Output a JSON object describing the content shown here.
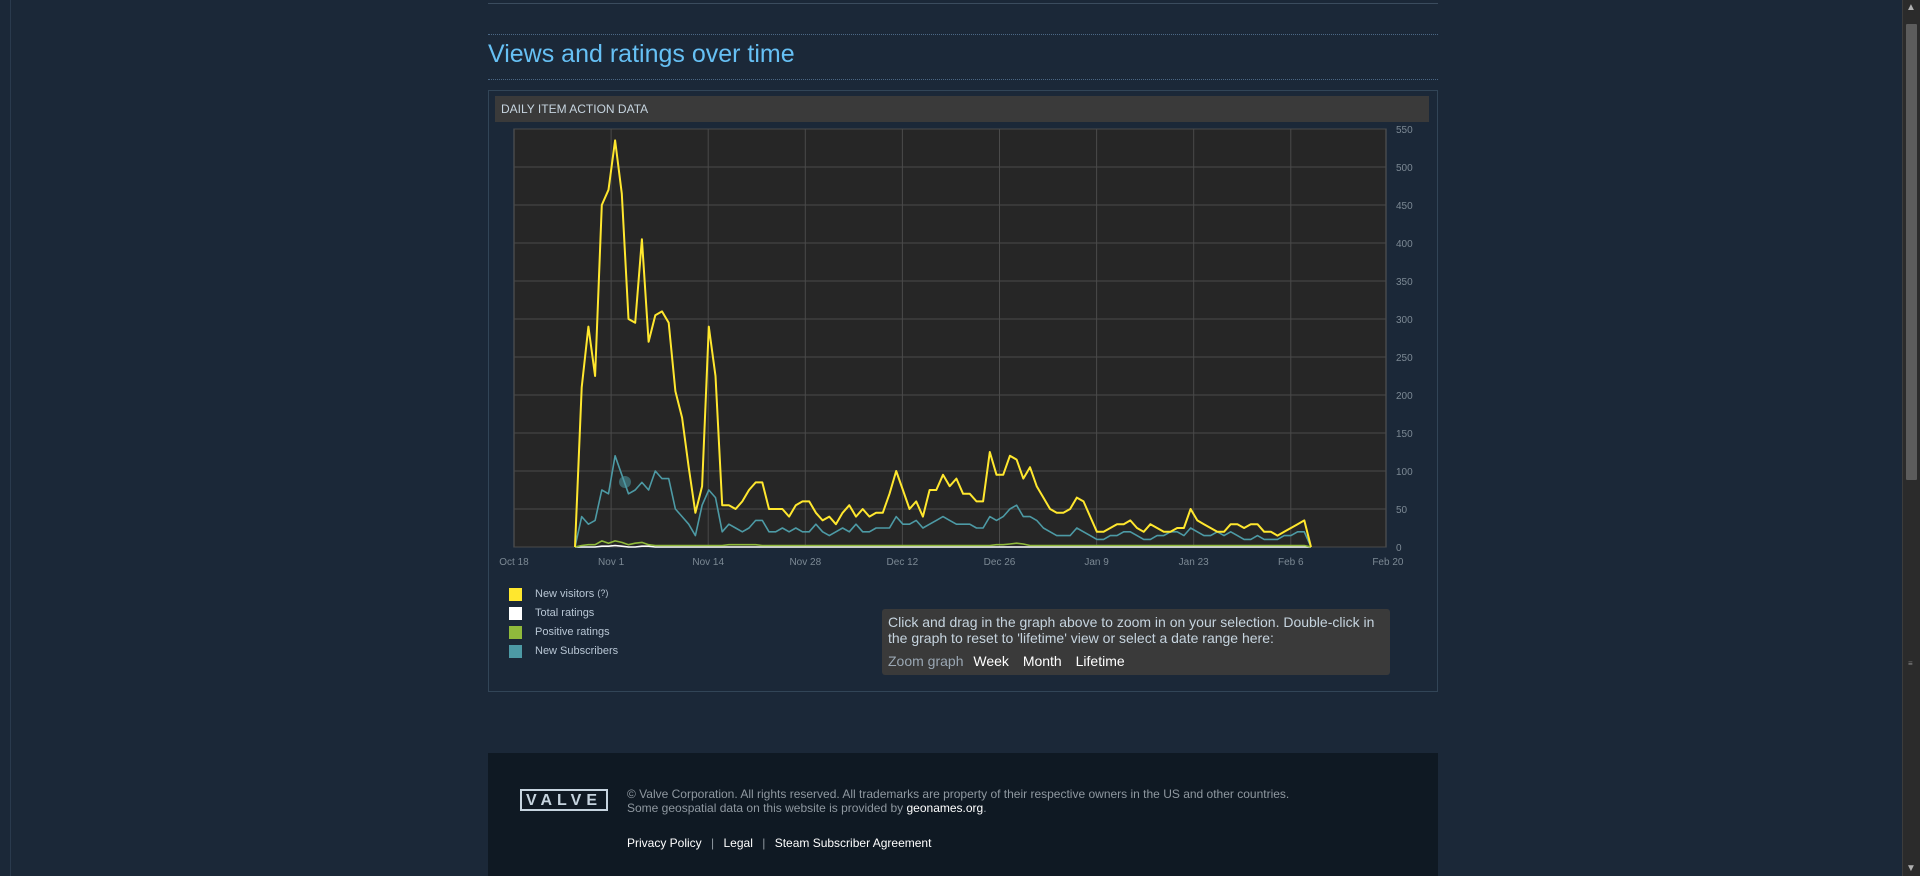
{
  "section": {
    "title": "Views and ratings over time"
  },
  "panel": {
    "header": "DAILY ITEM ACTION DATA"
  },
  "chart_data": {
    "type": "line",
    "y_ticks": [
      "550",
      "500",
      "450",
      "400",
      "350",
      "300",
      "250",
      "200",
      "150",
      "100",
      "50",
      "0"
    ],
    "x_ticks": [
      "Oct 18",
      "Nov 1",
      "Nov 14",
      "Nov 28",
      "Dec 12",
      "Dec 26",
      "Jan 9",
      "Jan 23",
      "Feb 6",
      "Feb 20"
    ],
    "ylim": [
      0,
      550
    ],
    "grid": true,
    "series": [
      {
        "name": "New visitors",
        "color": "#ffe72e",
        "values": [
          0,
          210,
          290,
          225,
          450,
          470,
          535,
          465,
          300,
          295,
          405,
          270,
          305,
          310,
          295,
          205,
          170,
          105,
          45,
          80,
          290,
          225,
          55,
          55,
          50,
          60,
          75,
          85,
          85,
          50,
          50,
          50,
          40,
          55,
          60,
          60,
          45,
          35,
          40,
          30,
          45,
          55,
          40,
          50,
          40,
          45,
          45,
          70,
          100,
          75,
          50,
          60,
          40,
          75,
          75,
          95,
          80,
          90,
          70,
          70,
          60,
          60,
          125,
          95,
          95,
          120,
          115,
          90,
          105,
          80,
          65,
          50,
          45,
          45,
          50,
          65,
          60,
          40,
          20,
          20,
          25,
          30,
          30,
          35,
          25,
          20,
          30,
          25,
          20,
          20,
          25,
          25,
          50,
          35,
          30,
          25,
          20,
          20,
          30,
          30,
          25,
          30,
          30,
          20,
          20,
          15,
          20,
          25,
          30,
          35,
          0
        ]
      },
      {
        "name": "Total ratings",
        "color": "#ffffff",
        "values": [
          0,
          0,
          0,
          0,
          1,
          1,
          2,
          1,
          0,
          0,
          1,
          1,
          0,
          0,
          0,
          0,
          0,
          0,
          0,
          0,
          0,
          0,
          0,
          0,
          0,
          0,
          0,
          0,
          0,
          0,
          0,
          0,
          0,
          0,
          0,
          0,
          0,
          0,
          0,
          0,
          0,
          0,
          0,
          0,
          0,
          0,
          0,
          0,
          0,
          0,
          0,
          0,
          0,
          0,
          0,
          0,
          0,
          0,
          0,
          0,
          0,
          0,
          0,
          0,
          0,
          0,
          0,
          0,
          0,
          0,
          0,
          0,
          0,
          0,
          0,
          0,
          0,
          0,
          0,
          0,
          0,
          0,
          0,
          0,
          0,
          0,
          0,
          0,
          0,
          0,
          0,
          0,
          0,
          0,
          0,
          0,
          0,
          0,
          0,
          0,
          0,
          0,
          0,
          0,
          0,
          0,
          0,
          0,
          0,
          0,
          0
        ]
      },
      {
        "name": "Positive ratings",
        "color": "#90ba3c",
        "values": [
          0,
          2,
          3,
          3,
          8,
          5,
          8,
          6,
          3,
          5,
          6,
          3,
          2,
          2,
          2,
          2,
          2,
          2,
          2,
          2,
          2,
          2,
          2,
          3,
          3,
          3,
          3,
          3,
          2,
          2,
          2,
          2,
          2,
          2,
          2,
          2,
          2,
          2,
          2,
          2,
          2,
          2,
          2,
          2,
          2,
          2,
          2,
          2,
          2,
          2,
          2,
          2,
          2,
          2,
          2,
          2,
          2,
          2,
          2,
          2,
          2,
          2,
          2,
          3,
          3,
          4,
          5,
          4,
          2,
          2,
          2,
          2,
          2,
          2,
          2,
          2,
          2,
          2,
          2,
          2,
          2,
          2,
          2,
          2,
          2,
          2,
          2,
          2,
          2,
          2,
          2,
          2,
          2,
          2,
          2,
          2,
          2,
          2,
          2,
          2,
          2,
          2,
          2,
          2,
          2,
          2,
          2,
          2,
          2,
          2,
          0
        ]
      },
      {
        "name": "New Subscribers",
        "color": "#4d9aa5",
        "values": [
          0,
          40,
          30,
          35,
          75,
          70,
          120,
          95,
          70,
          75,
          85,
          75,
          100,
          90,
          90,
          50,
          40,
          30,
          15,
          55,
          75,
          65,
          20,
          30,
          25,
          20,
          25,
          35,
          35,
          20,
          20,
          25,
          20,
          25,
          20,
          20,
          30,
          20,
          15,
          20,
          25,
          20,
          30,
          20,
          20,
          25,
          25,
          25,
          40,
          30,
          30,
          35,
          25,
          30,
          35,
          40,
          35,
          30,
          30,
          30,
          25,
          25,
          40,
          35,
          40,
          50,
          55,
          40,
          40,
          35,
          25,
          20,
          15,
          15,
          15,
          25,
          20,
          15,
          10,
          10,
          15,
          15,
          20,
          20,
          15,
          10,
          10,
          15,
          15,
          20,
          20,
          15,
          25,
          20,
          15,
          15,
          20,
          15,
          20,
          15,
          10,
          10,
          15,
          10,
          10,
          10,
          15,
          15,
          20,
          20,
          0
        ]
      }
    ]
  },
  "legend": {
    "items": [
      {
        "label": "New visitors",
        "color": "#ffe72e",
        "has_tooltip": true
      },
      {
        "label": "Total ratings",
        "color": "#ffffff",
        "has_tooltip": false
      },
      {
        "label": "Positive ratings",
        "color": "#90ba3c",
        "has_tooltip": false
      },
      {
        "label": "New Subscribers",
        "color": "#4d9aa5",
        "has_tooltip": false
      }
    ],
    "tooltip_mark": "(?)"
  },
  "zoom": {
    "help": "Click and drag in the graph above to zoom in on your selection. Double-click in the graph to reset to 'lifetime' view or select a date range here:",
    "label": "Zoom graph",
    "week": "Week",
    "month": "Month",
    "lifetime": "Lifetime"
  },
  "footer": {
    "logo_text": "VALVE",
    "copyright": "© Valve Corporation. All rights reserved. All trademarks are property of their respective owners in the US and other countries.",
    "geo_prefix": "Some geospatial data on this website is provided by ",
    "geo_link": "geonames.org",
    "geo_suffix": ".",
    "links": [
      "Privacy Policy",
      "Legal",
      "Steam Subscriber Agreement"
    ],
    "separator": "|"
  }
}
